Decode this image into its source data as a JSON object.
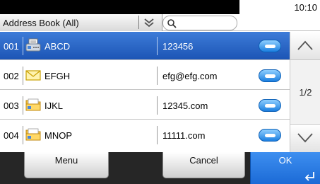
{
  "status": {
    "time": "10:10"
  },
  "toolbar": {
    "address_book_label": "Address Book (All)",
    "chevron_icon": "double-chevron-down-icon",
    "search_icon": "search-icon"
  },
  "entries": [
    {
      "number": "001",
      "icon": "fax-icon",
      "name": "ABCD",
      "destination": "123456",
      "selected": true
    },
    {
      "number": "002",
      "icon": "envelope-icon",
      "name": "EFGH",
      "destination": "efg@efg.com",
      "selected": false
    },
    {
      "number": "003",
      "icon": "folder-icon",
      "name": "IJKL",
      "destination": "12345.com",
      "selected": false
    },
    {
      "number": "004",
      "icon": "folder-icon",
      "name": "MNOP",
      "destination": "11111.com",
      "selected": false
    }
  ],
  "scroll": {
    "page_indicator": "1/2",
    "up_icon": "chevron-up-icon",
    "down_icon": "chevron-down-icon"
  },
  "bottom": {
    "menu_label": "Menu",
    "cancel_label": "Cancel",
    "ok_label": "OK",
    "ok_icon": "enter-icon"
  },
  "colors": {
    "selected_row": "#1c55b5",
    "ok_button": "#1b6ad6",
    "bottom_bar": "#262626",
    "status_bar": "#000000"
  }
}
